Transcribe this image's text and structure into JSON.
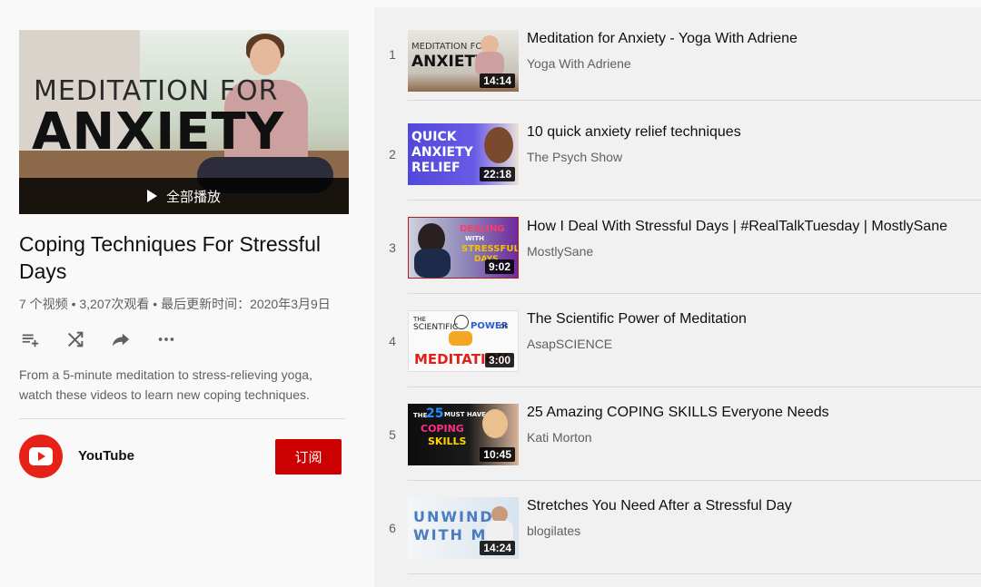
{
  "playlist": {
    "hero_title_line1": "MEDITATION FOR",
    "hero_title_line2": "ANXIETY",
    "play_all_label": "全部播放",
    "title": "Coping Techniques For Stressful Days",
    "meta": "7 个视频 • 3,207次观看 • 最后更新时间：2020年3月9日",
    "description": "From a 5-minute meditation to stress-relieving yoga, watch these videos to learn new coping techniques.",
    "actions": [
      "add-to-queue-icon",
      "shuffle-icon",
      "share-icon",
      "more-icon"
    ],
    "owner": {
      "name": "YouTube",
      "subscribe_label": "订阅"
    },
    "brand_color": "#cc0000"
  },
  "videos": [
    {
      "index": "1",
      "title": "Meditation for Anxiety - Yoga With Adriene",
      "channel": "Yoga With Adriene",
      "duration": "14:14",
      "thumb_text": "MEDITATION FOR ANXIETY"
    },
    {
      "index": "2",
      "title": "10 quick anxiety relief techniques",
      "channel": "The Psych Show",
      "duration": "22:18",
      "thumb_text": "QUICK ANXIETY RELIEF"
    },
    {
      "index": "3",
      "title": "How I Deal With Stressful Days | #RealTalkTuesday | MostlySane",
      "channel": "MostlySane",
      "duration": "9:02",
      "thumb_text": "DEALING WITH STRESSFUL DAYS"
    },
    {
      "index": "4",
      "title": "The Scientific Power of Meditation",
      "channel": "AsapSCIENCE",
      "duration": "3:00",
      "thumb_text": "THE SCIENTIFIC POWER OF MEDITATION"
    },
    {
      "index": "5",
      "title": "25 Amazing COPING SKILLS Everyone Needs",
      "channel": "Kati Morton",
      "duration": "10:45",
      "thumb_text": "THE 25 MUST HAVE COPING SKILLS"
    },
    {
      "index": "6",
      "title": "Stretches You Need After a Stressful Day",
      "channel": "blogilates",
      "duration": "14:24",
      "thumb_text": "UNWIND WITH ME"
    }
  ]
}
